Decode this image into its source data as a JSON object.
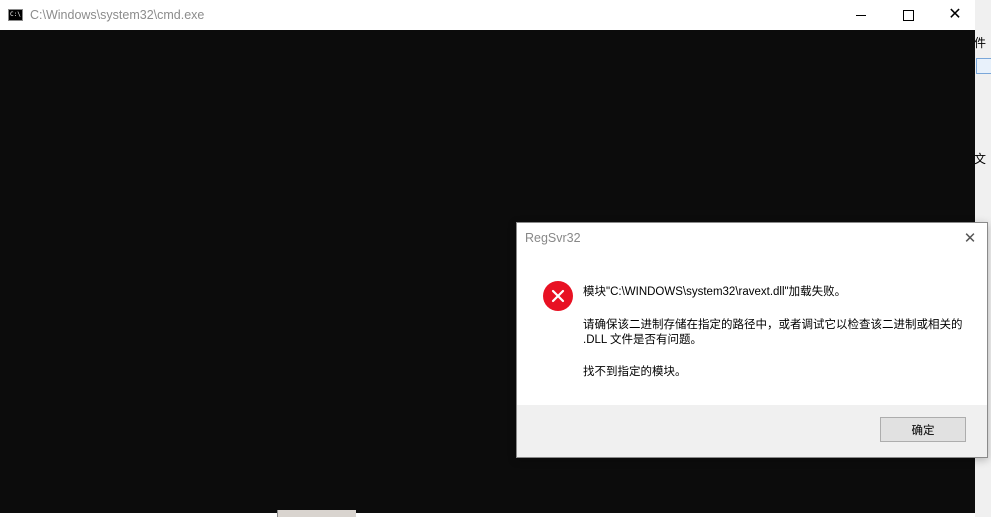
{
  "cmd_window": {
    "title": "C:\\Windows\\system32\\cmd.exe",
    "icon_label": "C:\\",
    "min_label": "—",
    "max_label": "☐",
    "close_label": "✕"
  },
  "background_window": {
    "snippet_top": "文件",
    "snippet_bottom": "的文",
    "scroll_up": "▲",
    "scroll_down": "▼"
  },
  "dialog": {
    "title": "RegSvr32",
    "close_label": "✕",
    "icon": "error-icon",
    "message_line1": "模块\"C:\\WINDOWS\\system32\\ravext.dll\"加载失败。",
    "message_line2": "请确保该二进制存储在指定的路径中，或者调试它以检查该二进制或相关的",
    "message_line3": ".DLL 文件是否有问题。",
    "message_line4": "找不到指定的模块。",
    "ok_label": "确定"
  },
  "colors": {
    "console_background": "#0c0c0c",
    "error_red": "#e81123",
    "dialog_footer": "#f0f0f0"
  }
}
